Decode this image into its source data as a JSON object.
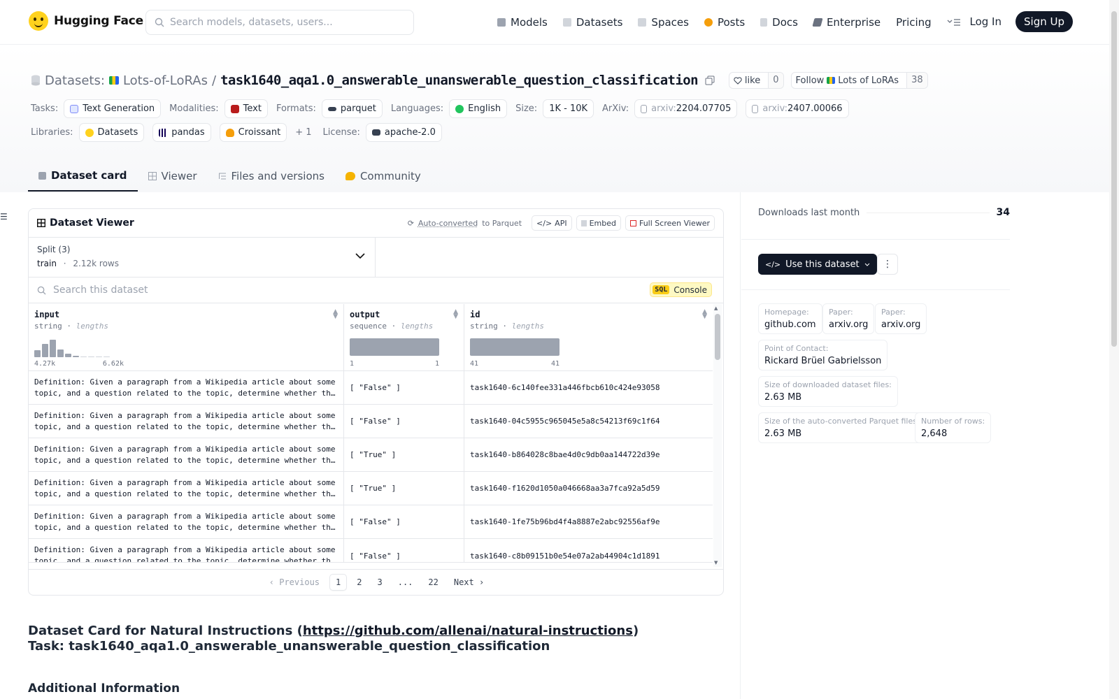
{
  "brand": {
    "name": "Hugging Face"
  },
  "search": {
    "placeholder": "Search models, datasets, users..."
  },
  "nav": {
    "items": [
      {
        "label": "Models",
        "icon": "cube-icon",
        "color": "#9ca3af"
      },
      {
        "label": "Datasets",
        "icon": "database-icon",
        "color": "#d1d5db"
      },
      {
        "label": "Spaces",
        "icon": "grid-icon",
        "color": "#d1d5db"
      },
      {
        "label": "Posts",
        "icon": "circle-icon",
        "color": "#f59e0b"
      },
      {
        "label": "Docs",
        "icon": "book-icon",
        "color": "#d1d5db"
      },
      {
        "label": "Enterprise",
        "icon": "enterprise-icon",
        "color": "#6b7280"
      },
      {
        "label": "Pricing",
        "icon": "",
        "color": ""
      }
    ],
    "login": "Log In",
    "signup": "Sign Up"
  },
  "header": {
    "section": "Datasets:",
    "org": "Lots-of-LoRAs",
    "separator": "/",
    "name": "task1640_aqa1.0_answerable_unanswerable_question_classification",
    "like_label": "like",
    "like_count": "0",
    "follow_label": "Follow",
    "follow_org": "Lots of LoRAs",
    "follow_count": "38"
  },
  "meta": {
    "tasks_label": "Tasks:",
    "task": "Text Generation",
    "modalities_label": "Modalities:",
    "modality": "Text",
    "formats_label": "Formats:",
    "format": "parquet",
    "languages_label": "Languages:",
    "language": "English",
    "size_label": "Size:",
    "size": "1K - 10K",
    "arxiv_label": "ArXiv:",
    "arxiv_prefix": "arxiv:",
    "arxiv": [
      "2204.07705",
      "2407.00066"
    ],
    "libraries_label": "Libraries:",
    "libraries": [
      "Datasets",
      "pandas",
      "Croissant"
    ],
    "libraries_more": "+ 1",
    "license_label": "License:",
    "license": "apache-2.0"
  },
  "tabs": [
    {
      "label": "Dataset card",
      "active": true
    },
    {
      "label": "Viewer",
      "active": false
    },
    {
      "label": "Files and versions",
      "active": false
    },
    {
      "label": "Community",
      "active": false
    }
  ],
  "viewer": {
    "title": "Dataset Viewer",
    "auto_converted": "Auto-converted",
    "to_parquet": "to Parquet",
    "api": "API",
    "embed": "Embed",
    "full_screen": "Full Screen Viewer",
    "split_label": "Split (3)",
    "split_value": "train",
    "split_dot": "·",
    "split_rows": "2.12k rows",
    "search_placeholder": "Search this dataset",
    "sql_badge": "SQL",
    "sql_label": "Console",
    "columns": [
      {
        "name": "input",
        "type": "string",
        "stat": "lengths",
        "min": "4.27k",
        "max": "6.62k",
        "histogram": [
          0.32,
          0.62,
          0.82,
          0.36,
          0.16,
          0.08,
          0.04,
          0.04,
          0.04,
          0.04
        ]
      },
      {
        "name": "output",
        "type": "sequence",
        "stat": "lengths",
        "min": "1",
        "max": "1"
      },
      {
        "name": "id",
        "type": "string",
        "stat": "lengths",
        "min": "41",
        "max": "41"
      }
    ],
    "rows": [
      {
        "input": "Definition: Given a paragraph from a Wikipedia article about some topic, and a question related to the topic, determine whether the question is answerable from the paragraph.",
        "output": "[ \"False\" ]",
        "id": "task1640-6c140fee331a446fbcb610c424e93058"
      },
      {
        "input": "Definition: Given a paragraph from a Wikipedia article about some topic, and a question related to the topic, determine whether the question is answerable from the paragraph.",
        "output": "[ \"False\" ]",
        "id": "task1640-04c5955c965045e5a8c54213f69c1f64"
      },
      {
        "input": "Definition: Given a paragraph from a Wikipedia article about some topic, and a question related to the topic, determine whether the question is answerable from the paragraph.",
        "output": "[ \"True\" ]",
        "id": "task1640-b864028c8bae4d0c9db0aa144722d39e"
      },
      {
        "input": "Definition: Given a paragraph from a Wikipedia article about some topic, and a question related to the topic, determine whether the question is answerable from the paragraph.",
        "output": "[ \"True\" ]",
        "id": "task1640-f1620d1050a046668aa3a7fca92a5d59"
      },
      {
        "input": "Definition: Given a paragraph from a Wikipedia article about some topic, and a question related to the topic, determine whether the question is answerable from the paragraph.",
        "output": "[ \"False\" ]",
        "id": "task1640-1fe75b96bd4f4a8887e2abc92556af9e"
      },
      {
        "input": "Definition: Given a paragraph from a Wikipedia article about some topic, and a question related to the topic, determine whether the question is answerable from the paragraph.",
        "output": "[ \"False\" ]",
        "id": "task1640-c8b09151b0e54e07a2ab44904c1d1891"
      }
    ],
    "pager": {
      "previous": "Previous",
      "pages": [
        "1",
        "2",
        "3",
        "...",
        "22"
      ],
      "current": "1",
      "next": "Next"
    }
  },
  "card": {
    "title_prefix": "Dataset Card for Natural Instructions (",
    "title_link": "https://github.com/allenai/natural-instructions",
    "title_suffix": ") Task: task1640_aqa1.0_answerable_unanswerable_question_classification",
    "subheading": "Additional Information"
  },
  "sidebar": {
    "downloads_label": "Downloads last month",
    "downloads_count": "34",
    "use_dataset": "Use this dataset",
    "info": [
      {
        "key": "Homepage:",
        "value": "github.com"
      },
      {
        "key": "Paper:",
        "value": "arxiv.org"
      },
      {
        "key": "Paper:",
        "value": "arxiv.org"
      },
      {
        "key": "Point of Contact:",
        "value": "Rickard Brüel Gabrielsson"
      },
      {
        "key": "Size of downloaded dataset files:",
        "value": "2.63 MB"
      },
      {
        "key": "Size of the auto-converted Parquet files:",
        "value": "2.63 MB"
      },
      {
        "key": "Number of rows:",
        "value": "2,648"
      }
    ]
  },
  "colors": {
    "accent": "#111827",
    "brand_yellow": "#ffd21e",
    "sql_yellow": "#facc15",
    "muted": "#6b7280"
  }
}
